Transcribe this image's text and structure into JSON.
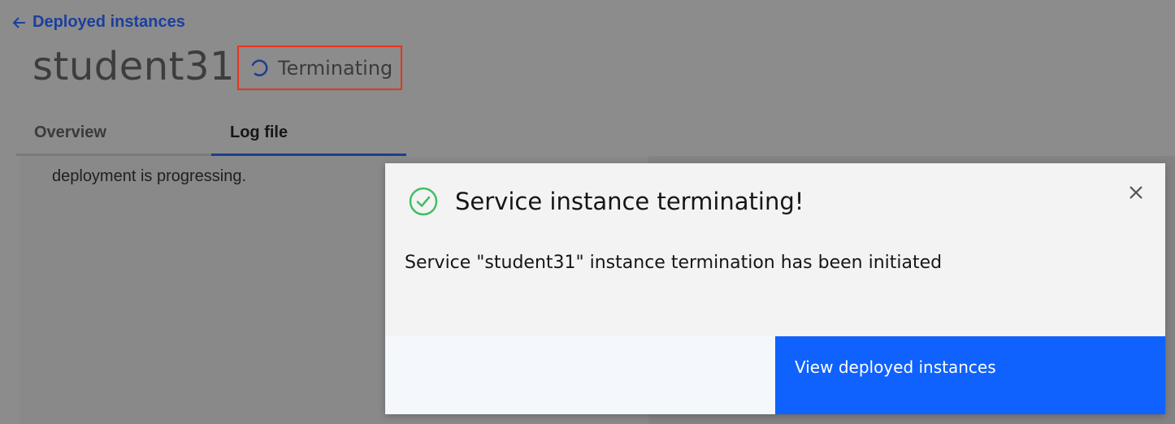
{
  "header": {
    "back_link_label": "Deployed instances",
    "instance_name": "student31",
    "status": "Terminating"
  },
  "tabs": [
    {
      "label": "Overview",
      "active": false
    },
    {
      "label": "Log file",
      "active": true
    }
  ],
  "content": {
    "log_text": "deployment is progressing."
  },
  "modal": {
    "title": "Service instance terminating!",
    "message": "Service \"student31\" instance termination has been initiated",
    "primary_button": "View deployed instances"
  },
  "icons": {
    "back": "arrow-left-icon",
    "status": "spinner-icon",
    "success": "checkmark-circle-icon",
    "close": "close-icon"
  },
  "colors": {
    "accent_blue": "#0f62fe",
    "link_blue": "#1b3f9e",
    "success_green": "#42be65",
    "highlight_red": "#e8341c"
  }
}
